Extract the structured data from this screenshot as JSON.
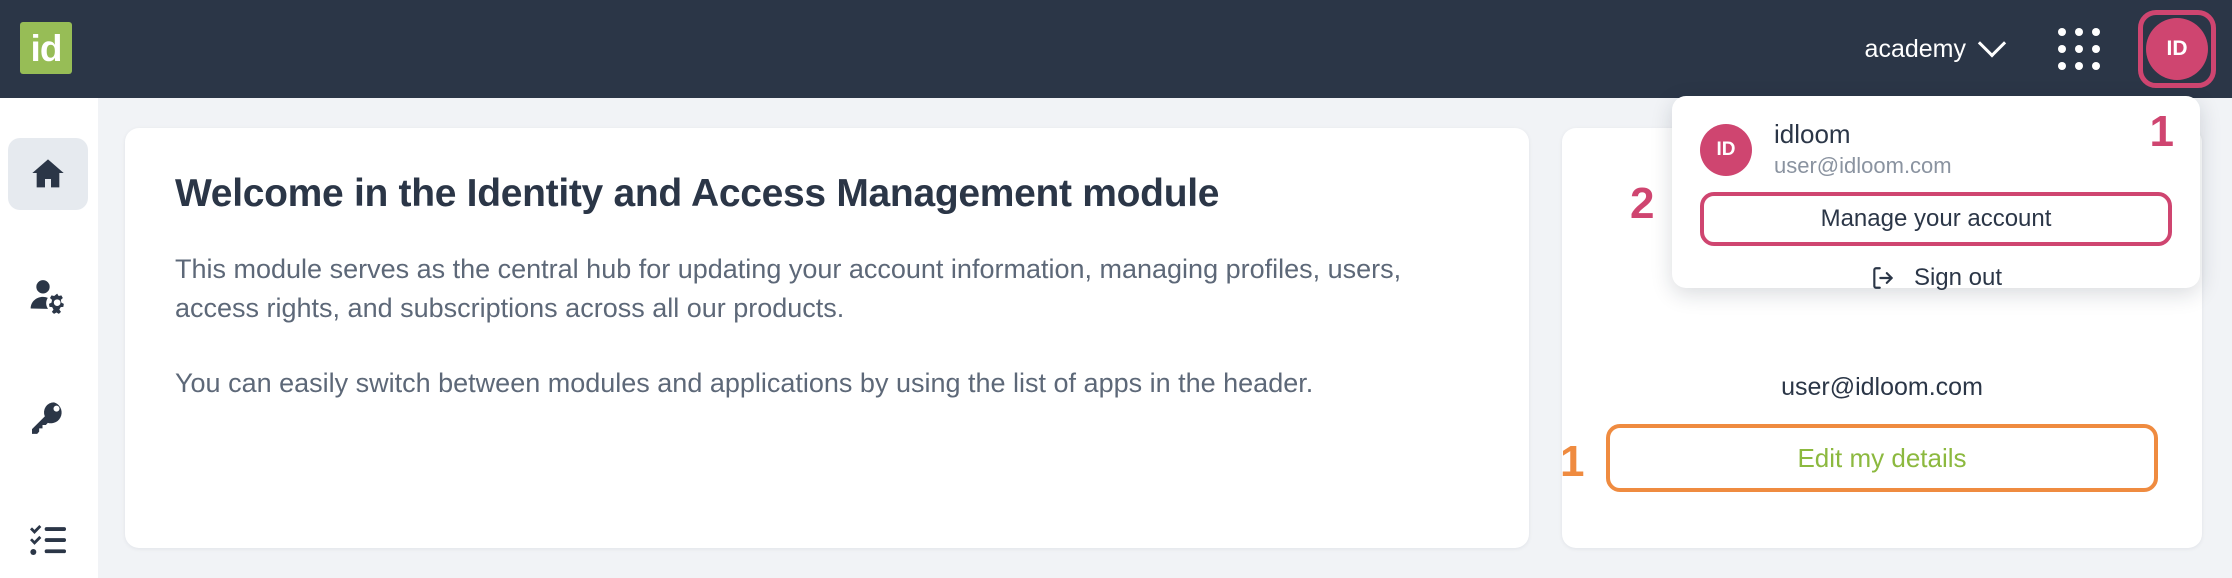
{
  "header": {
    "logo_text": "id",
    "org_name": "academy",
    "chevron_icon": "chevron-down-icon",
    "apps_icon": "app-grid-icon",
    "avatar_initials": "ID"
  },
  "sidebar": {
    "items": [
      {
        "icon": "home-icon",
        "active": true
      },
      {
        "icon": "user-settings-icon",
        "active": false
      },
      {
        "icon": "key-icon",
        "active": false
      },
      {
        "icon": "checklist-icon",
        "active": false
      }
    ]
  },
  "main": {
    "welcome_card": {
      "title": "Welcome in the Identity and Access Management module",
      "paragraphs": [
        "This module serves as the central hub for updating your account information, managing profiles, users, access rights, and subscriptions across all our products.",
        "You can easily switch between modules and applications by using the list of apps in the header."
      ]
    },
    "profile_card": {
      "email": "user@idloom.com",
      "edit_button_label": "Edit my details",
      "annotation": "1"
    }
  },
  "dropdown": {
    "avatar_initials": "ID",
    "name": "idloom",
    "email": "user@idloom.com",
    "manage_label": "Manage your account",
    "signout_label": "Sign out",
    "signout_icon": "logout-icon",
    "annotation_avatar": "1",
    "annotation_manage": "2"
  },
  "colors": {
    "header_bg": "#2b3647",
    "page_bg": "#f1f3f6",
    "brand_green": "#97bd56",
    "accent_pink": "#cf4570",
    "accent_orange": "#ef8b40",
    "link_green": "#8cb93f"
  }
}
